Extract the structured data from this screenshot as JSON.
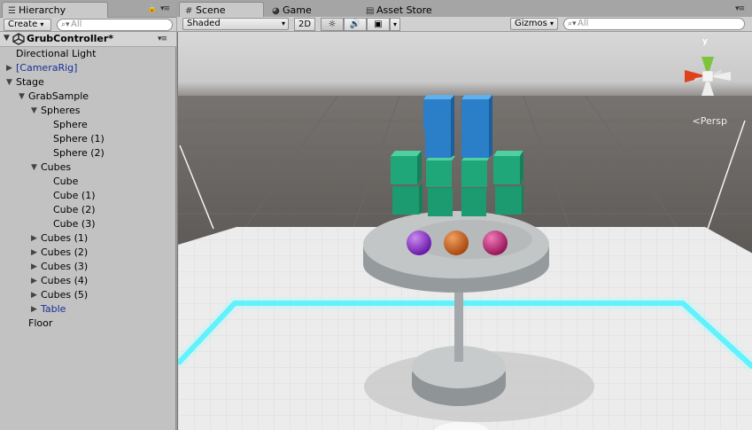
{
  "hierarchy": {
    "tab_label": "Hierarchy",
    "create_label": "Create",
    "search_placeholder": "All",
    "scene_name": "GrubController*",
    "items": [
      {
        "label": "Directional Light",
        "depth": 1,
        "arrow": "",
        "prefab": false
      },
      {
        "label": "[CameraRig]",
        "depth": 1,
        "arrow": "collapsed",
        "prefab": true
      },
      {
        "label": "Stage",
        "depth": 1,
        "arrow": "expanded",
        "prefab": false
      },
      {
        "label": "GrabSample",
        "depth": 2,
        "arrow": "expanded",
        "prefab": false
      },
      {
        "label": "Spheres",
        "depth": 3,
        "arrow": "expanded",
        "prefab": false
      },
      {
        "label": "Sphere",
        "depth": 4,
        "arrow": "",
        "prefab": false
      },
      {
        "label": "Sphere (1)",
        "depth": 4,
        "arrow": "",
        "prefab": false
      },
      {
        "label": "Sphere (2)",
        "depth": 4,
        "arrow": "",
        "prefab": false
      },
      {
        "label": "Cubes",
        "depth": 3,
        "arrow": "expanded",
        "prefab": false
      },
      {
        "label": "Cube",
        "depth": 4,
        "arrow": "",
        "prefab": false
      },
      {
        "label": "Cube (1)",
        "depth": 4,
        "arrow": "",
        "prefab": false
      },
      {
        "label": "Cube (2)",
        "depth": 4,
        "arrow": "",
        "prefab": false
      },
      {
        "label": "Cube (3)",
        "depth": 4,
        "arrow": "",
        "prefab": false
      },
      {
        "label": "Cubes (1)",
        "depth": 3,
        "arrow": "collapsed",
        "prefab": false
      },
      {
        "label": "Cubes (2)",
        "depth": 3,
        "arrow": "collapsed",
        "prefab": false
      },
      {
        "label": "Cubes (3)",
        "depth": 3,
        "arrow": "collapsed",
        "prefab": false
      },
      {
        "label": "Cubes (4)",
        "depth": 3,
        "arrow": "collapsed",
        "prefab": false
      },
      {
        "label": "Cubes (5)",
        "depth": 3,
        "arrow": "collapsed",
        "prefab": false
      },
      {
        "label": "Table",
        "depth": 3,
        "arrow": "collapsed",
        "prefab": true
      },
      {
        "label": "Floor",
        "depth": 2,
        "arrow": "",
        "prefab": false
      }
    ]
  },
  "scene_view": {
    "tabs": [
      {
        "label": "Scene",
        "icon": "grid-icon"
      },
      {
        "label": "Game",
        "icon": "pacman-icon"
      },
      {
        "label": "Asset Store",
        "icon": "store-icon"
      }
    ],
    "shading_mode": "Shaded",
    "mode_2d": "2D",
    "gizmos_label": "Gizmos",
    "search_placeholder": "All",
    "axis_label": "y",
    "projection_label": "Persp"
  },
  "colors": {
    "prefab_text": "#1a2f9a",
    "sphere_purple": "#8a2bd0",
    "sphere_orange": "#d4651a",
    "sphere_magenta": "#c0207a",
    "cube_blue": "#2a7fc8",
    "cube_green": "#1fa77a",
    "floor_glow": "#2ff0ff",
    "gizmo_y": "#7dc43a",
    "gizmo_x": "#e0401a"
  }
}
